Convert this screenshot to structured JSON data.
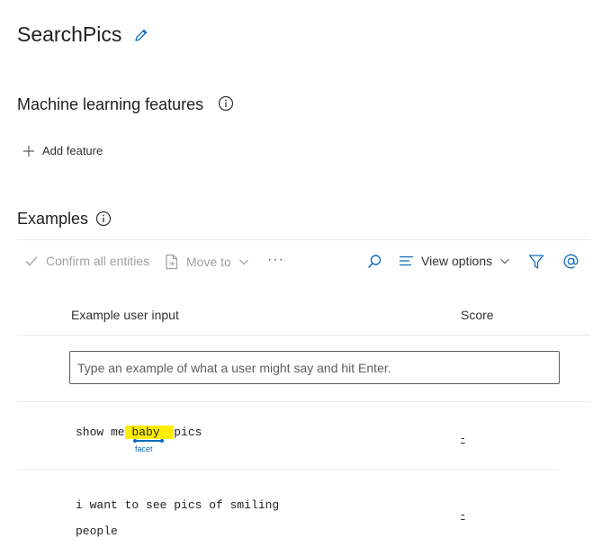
{
  "app": {
    "title": "SearchPics"
  },
  "ml_features": {
    "title": "Machine learning features",
    "add_label": "Add feature"
  },
  "examples": {
    "title": "Examples",
    "toolbar": {
      "confirm_label": "Confirm all entities",
      "move_label": "Move to",
      "more_label": "···",
      "view_options_label": "View options"
    },
    "columns": {
      "input": "Example user input",
      "score": "Score"
    },
    "input_placeholder": "Type an example of what a user might say and hit Enter.",
    "rows": [
      {
        "before": "show me",
        "highlight": " baby ",
        "after": "pics",
        "entity_label": "facet",
        "score": "-"
      },
      {
        "line1": "i want to see pics of smiling",
        "line2": "people",
        "score": "-"
      }
    ]
  },
  "colors": {
    "accent": "#0f6cbd",
    "highlight": "#ffee00"
  },
  "icons": [
    "pencil-icon",
    "info-icon",
    "plus-icon",
    "checkmark-icon",
    "move-icon",
    "chevron-down-icon",
    "search-icon",
    "list-icon",
    "filter-icon",
    "at-icon"
  ]
}
